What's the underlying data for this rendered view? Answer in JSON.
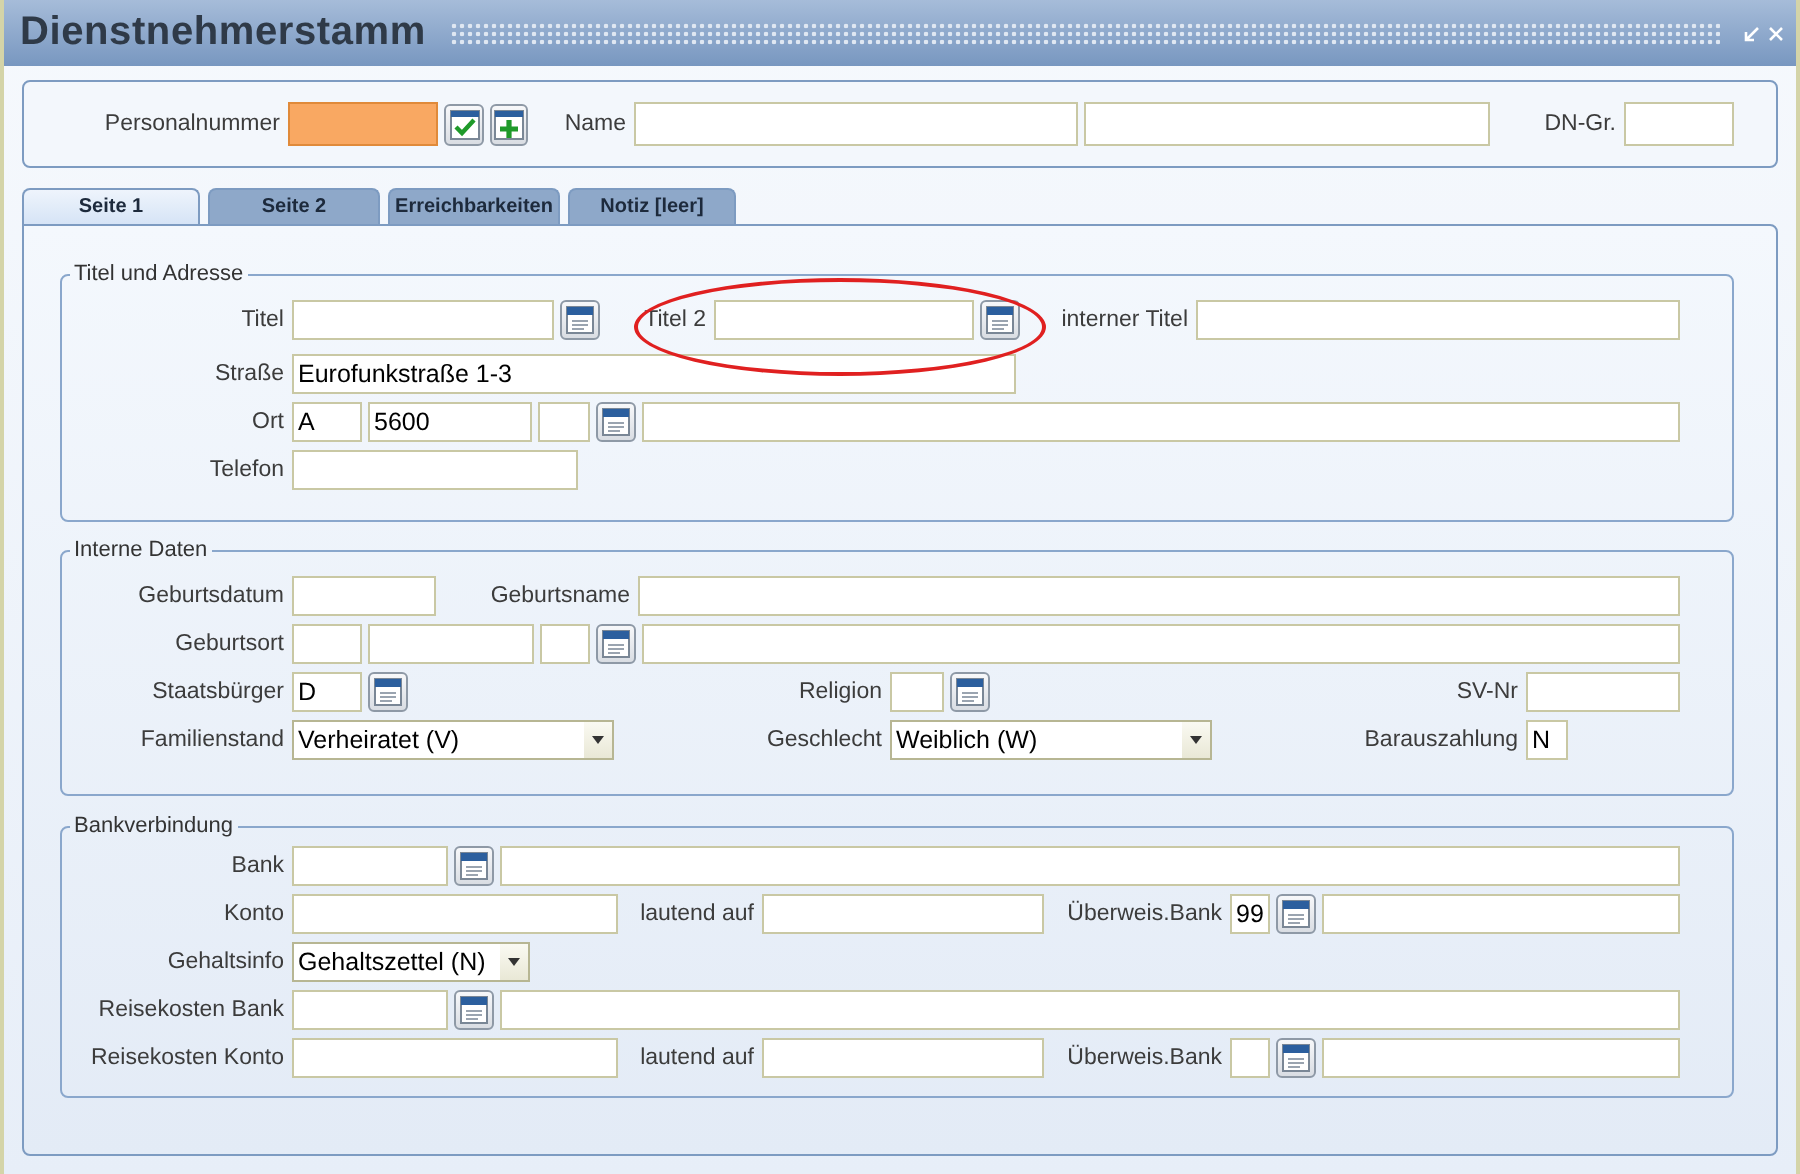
{
  "window": {
    "title": "Dienstnehmerstamm"
  },
  "header": [
    {
      "kind": "label",
      "text": "Personalnummer"
    },
    {
      "kind": "field",
      "focused": true
    },
    {
      "kind": "confirm"
    },
    {
      "kind": "add"
    },
    {
      "kind": "label",
      "text": "Name"
    },
    {
      "kind": "field",
      "focused": false
    },
    {
      "kind": "field",
      "focused": false
    },
    {
      "kind": "label",
      "text": "DN-Gr."
    },
    {
      "kind": "field",
      "focused": false
    }
  ],
  "tabs": [
    {
      "label": "Seite 1",
      "selected": true
    },
    {
      "label": "Seite 2",
      "selected": false
    },
    {
      "label": "Erreichbarkeiten",
      "selected": false
    },
    {
      "label": "Notiz [leer]",
      "selected": false
    }
  ],
  "sections": [
    {
      "title": "Titel und Adresse",
      "rows": [
        {
          "fields": [
            {
              "kind": "label",
              "text": "Titel"
            },
            {
              "kind": "field"
            },
            {
              "kind": "lookup"
            },
            {
              "kind": "label",
              "text": "Titel 2",
              "circled": true
            },
            {
              "kind": "field"
            },
            {
              "kind": "lookup"
            },
            {
              "kind": "label",
              "text": "interner Titel"
            },
            {
              "kind": "field"
            }
          ]
        },
        {
          "fields": [
            {
              "kind": "label",
              "text": "Straße"
            },
            {
              "kind": "field",
              "value": "Eurofunkstraße 1-3"
            }
          ]
        },
        {
          "fields": [
            {
              "kind": "label",
              "text": "Ort"
            },
            {
              "kind": "field",
              "value": "A"
            },
            {
              "kind": "field",
              "value": "5600"
            },
            {
              "kind": "field"
            },
            {
              "kind": "lookup"
            },
            {
              "kind": "field"
            }
          ]
        },
        {
          "fields": [
            {
              "kind": "label",
              "text": "Telefon"
            },
            {
              "kind": "field"
            }
          ]
        }
      ]
    },
    {
      "title": "Interne Daten",
      "rows": [
        {
          "fields": [
            {
              "kind": "label",
              "text": "Geburtsdatum"
            },
            {
              "kind": "field"
            },
            {
              "kind": "label",
              "text": "Geburtsname"
            },
            {
              "kind": "field"
            }
          ]
        },
        {
          "fields": [
            {
              "kind": "label",
              "text": "Geburtsort"
            },
            {
              "kind": "field"
            },
            {
              "kind": "field"
            },
            {
              "kind": "field"
            },
            {
              "kind": "lookup"
            },
            {
              "kind": "field"
            }
          ]
        },
        {
          "fields": [
            {
              "kind": "label",
              "text": "Staatsbürger"
            },
            {
              "kind": "field",
              "value": "D"
            },
            {
              "kind": "lookup"
            },
            {
              "kind": "label",
              "text": "Religion"
            },
            {
              "kind": "field"
            },
            {
              "kind": "lookup"
            },
            {
              "kind": "label",
              "text": "SV-Nr"
            },
            {
              "kind": "field"
            }
          ]
        },
        {
          "fields": [
            {
              "kind": "label",
              "text": "Familienstand"
            },
            {
              "kind": "select",
              "value": "Verheiratet (V)"
            },
            {
              "kind": "label",
              "text": "Geschlecht"
            },
            {
              "kind": "select",
              "value": "Weiblich (W)"
            },
            {
              "kind": "label",
              "text": "Barauszahlung"
            },
            {
              "kind": "field",
              "value": "N"
            }
          ]
        }
      ]
    },
    {
      "title": "Bankverbindung",
      "rows": [
        {
          "fields": [
            {
              "kind": "label",
              "text": "Bank"
            },
            {
              "kind": "field"
            },
            {
              "kind": "lookup"
            },
            {
              "kind": "field"
            }
          ]
        },
        {
          "fields": [
            {
              "kind": "label",
              "text": "Konto"
            },
            {
              "kind": "field"
            },
            {
              "kind": "label",
              "text": "lautend auf"
            },
            {
              "kind": "field"
            },
            {
              "kind": "label",
              "text": "Überweis.Bank"
            },
            {
              "kind": "field",
              "value": "99"
            },
            {
              "kind": "lookup"
            },
            {
              "kind": "field"
            }
          ]
        },
        {
          "fields": [
            {
              "kind": "label",
              "text": "Gehaltsinfo"
            },
            {
              "kind": "select",
              "value": "Gehaltszettel (N)"
            }
          ]
        },
        {
          "fields": [
            {
              "kind": "label",
              "text": "Reisekosten Bank"
            },
            {
              "kind": "field"
            },
            {
              "kind": "lookup"
            },
            {
              "kind": "field"
            }
          ]
        },
        {
          "fields": [
            {
              "kind": "label",
              "text": "Reisekosten Konto"
            },
            {
              "kind": "field"
            },
            {
              "kind": "label",
              "text": "lautend auf"
            },
            {
              "kind": "field"
            },
            {
              "kind": "label",
              "text": "Überweis.Bank"
            },
            {
              "kind": "field"
            },
            {
              "kind": "lookup"
            },
            {
              "kind": "field"
            }
          ]
        }
      ]
    }
  ]
}
